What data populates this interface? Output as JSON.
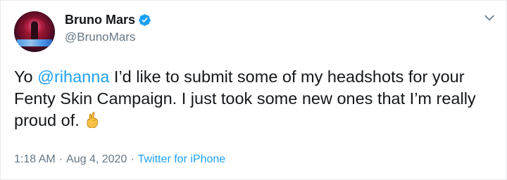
{
  "author": {
    "display_name": "Bruno Mars",
    "handle": "@BrunoMars",
    "verified": true
  },
  "tweet": {
    "text_before_mention": "Yo ",
    "mention": "@rihanna",
    "text_after_mention": " I’d like to submit some of my headshots for your Fenty Skin Campaign. I just took some new ones that I’m really proud of.",
    "emoji": "crossed-fingers"
  },
  "meta": {
    "time": "1:18 AM",
    "separator": "·",
    "date": "Aug 4, 2020",
    "source": "Twitter for iPhone"
  },
  "colors": {
    "accent": "#1da1f2",
    "text": "#14171a",
    "muted": "#657786"
  },
  "icons": {
    "verified": "verified-badge-icon",
    "menu": "chevron-down-icon"
  }
}
